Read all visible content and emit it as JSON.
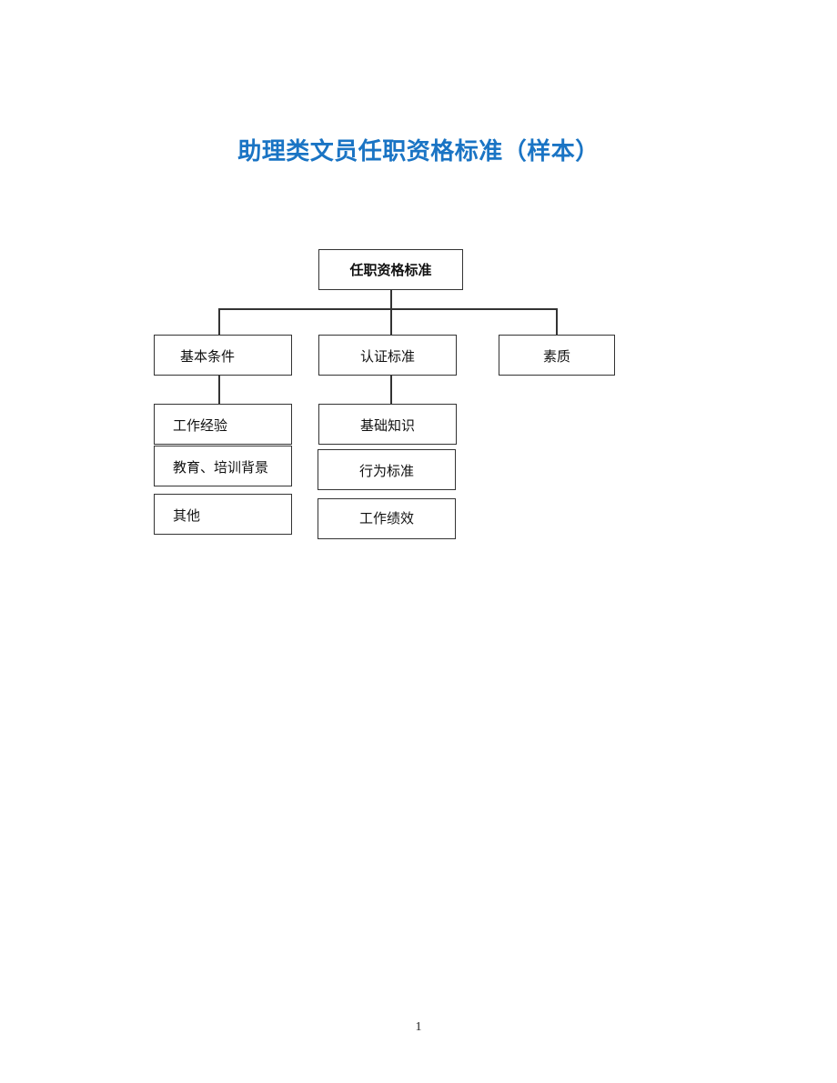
{
  "document": {
    "title": "助理类文员任职资格标准（样本）",
    "page_number": "1"
  },
  "org_chart": {
    "root": "任职资格标准",
    "branches": [
      {
        "label": "基本条件",
        "children": [
          "工作经验",
          "教育、培训背景",
          "其他"
        ]
      },
      {
        "label": "认证标准",
        "children": [
          "基础知识",
          "行为标准",
          "工作绩效"
        ]
      },
      {
        "label": "素质",
        "children": []
      }
    ]
  }
}
